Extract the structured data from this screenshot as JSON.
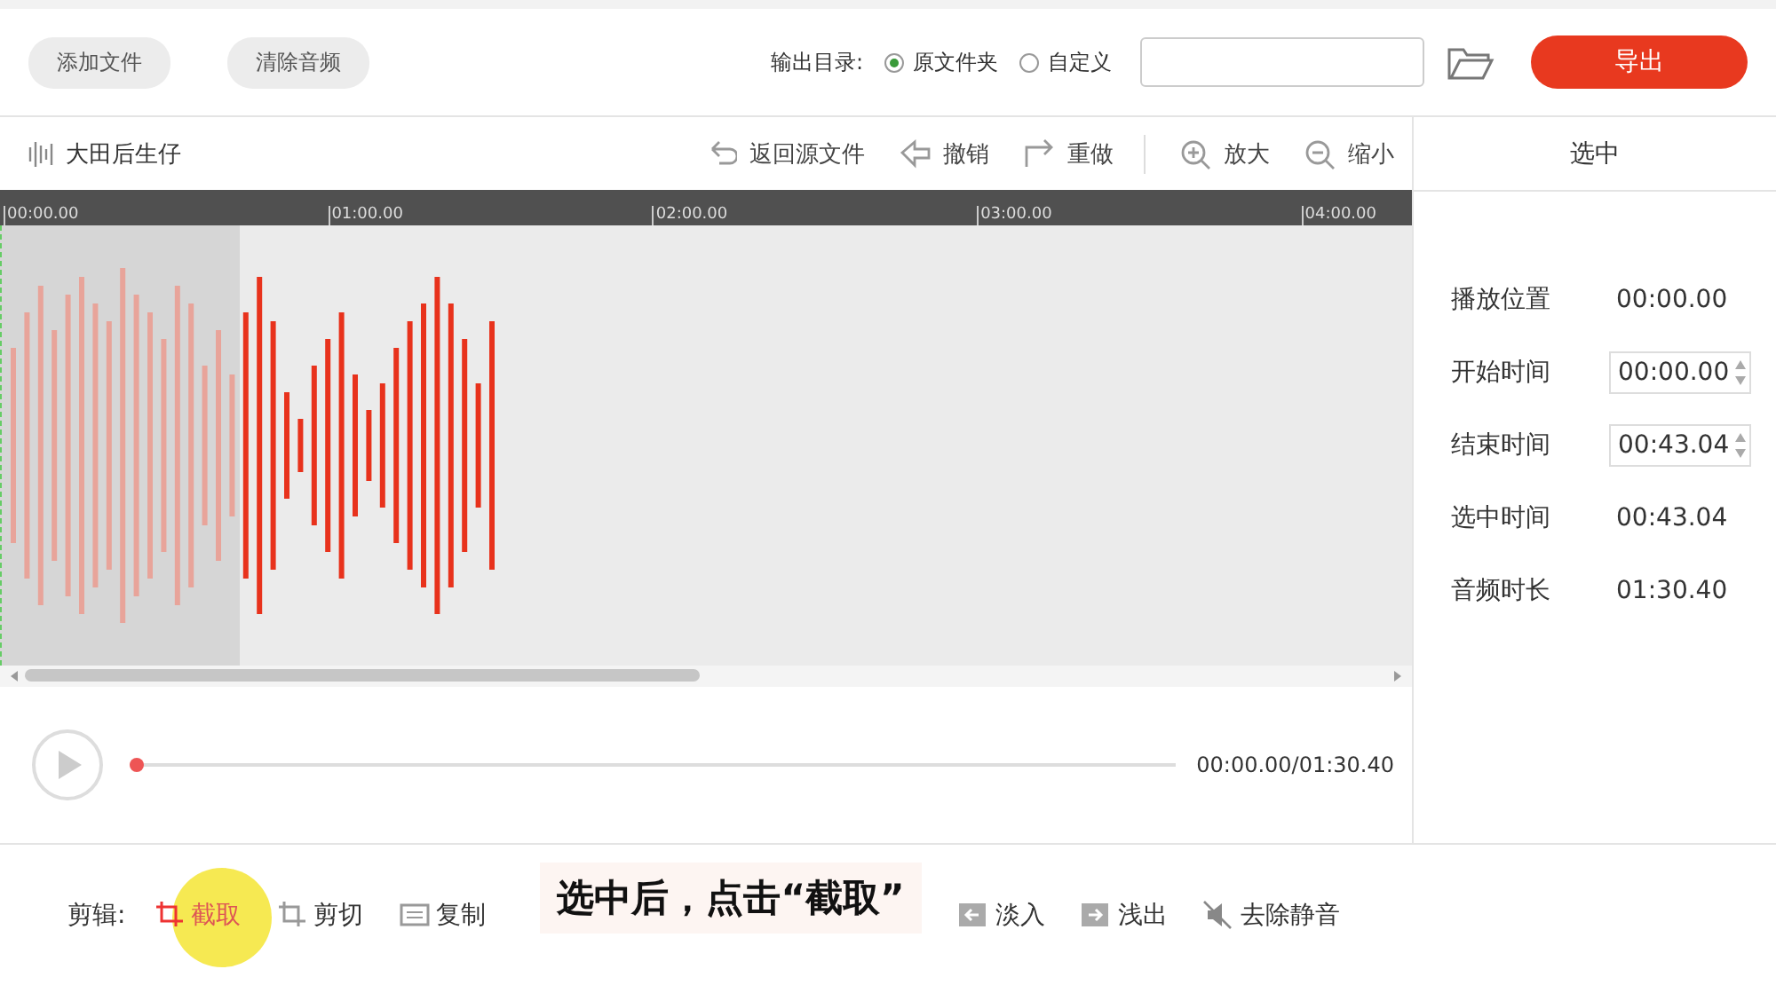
{
  "top_buttons": [
    "添加文件",
    "清除音频"
  ],
  "output": {
    "label": "输出目录:",
    "options": [
      {
        "label": "原文件夹",
        "selected": true
      },
      {
        "label": "自定义",
        "selected": false
      }
    ],
    "export": "导出"
  },
  "file_name": "大田后生仔",
  "tools": [
    {
      "label": "返回源文件",
      "kind": "back"
    },
    {
      "label": "撤销",
      "kind": "undo"
    },
    {
      "label": "重做",
      "kind": "redo"
    },
    {
      "label": "放大",
      "kind": "zoomin"
    },
    {
      "label": "缩小",
      "kind": "zoomout"
    }
  ],
  "ruler": [
    "00:00.00",
    "01:00.00",
    "02:00.00",
    "03:00.00",
    "04:00.00"
  ],
  "selection": {
    "level": 0.17
  },
  "player": {
    "level": 0.0,
    "time": "00:00.00/01:30.40"
  },
  "panel": {
    "title": "选中",
    "rows": [
      {
        "label": "播放位置",
        "value": "00:00.00",
        "kind": "text"
      },
      {
        "label": "开始时间",
        "value": "00:00.00",
        "kind": "spin"
      },
      {
        "label": "结束时间",
        "value": "00:43.04",
        "kind": "spin"
      },
      {
        "label": "选中时间",
        "value": "00:43.04",
        "kind": "text"
      },
      {
        "label": "音频时长",
        "value": "01:30.40",
        "kind": "text"
      }
    ]
  },
  "edit": {
    "label": "剪辑:",
    "items": [
      {
        "label": "截取",
        "kind": "crop",
        "selected": true
      },
      {
        "label": "剪切",
        "kind": "cut",
        "selected": false
      },
      {
        "label": "复制",
        "kind": "copy",
        "selected": false
      },
      {
        "label": "淡入",
        "kind": "fadein",
        "selected": false
      },
      {
        "label": "浅出",
        "kind": "fadeout",
        "selected": false
      },
      {
        "label": "去除静音",
        "kind": "silence",
        "selected": false
      }
    ]
  },
  "caption": "选中后，点击“截取”"
}
